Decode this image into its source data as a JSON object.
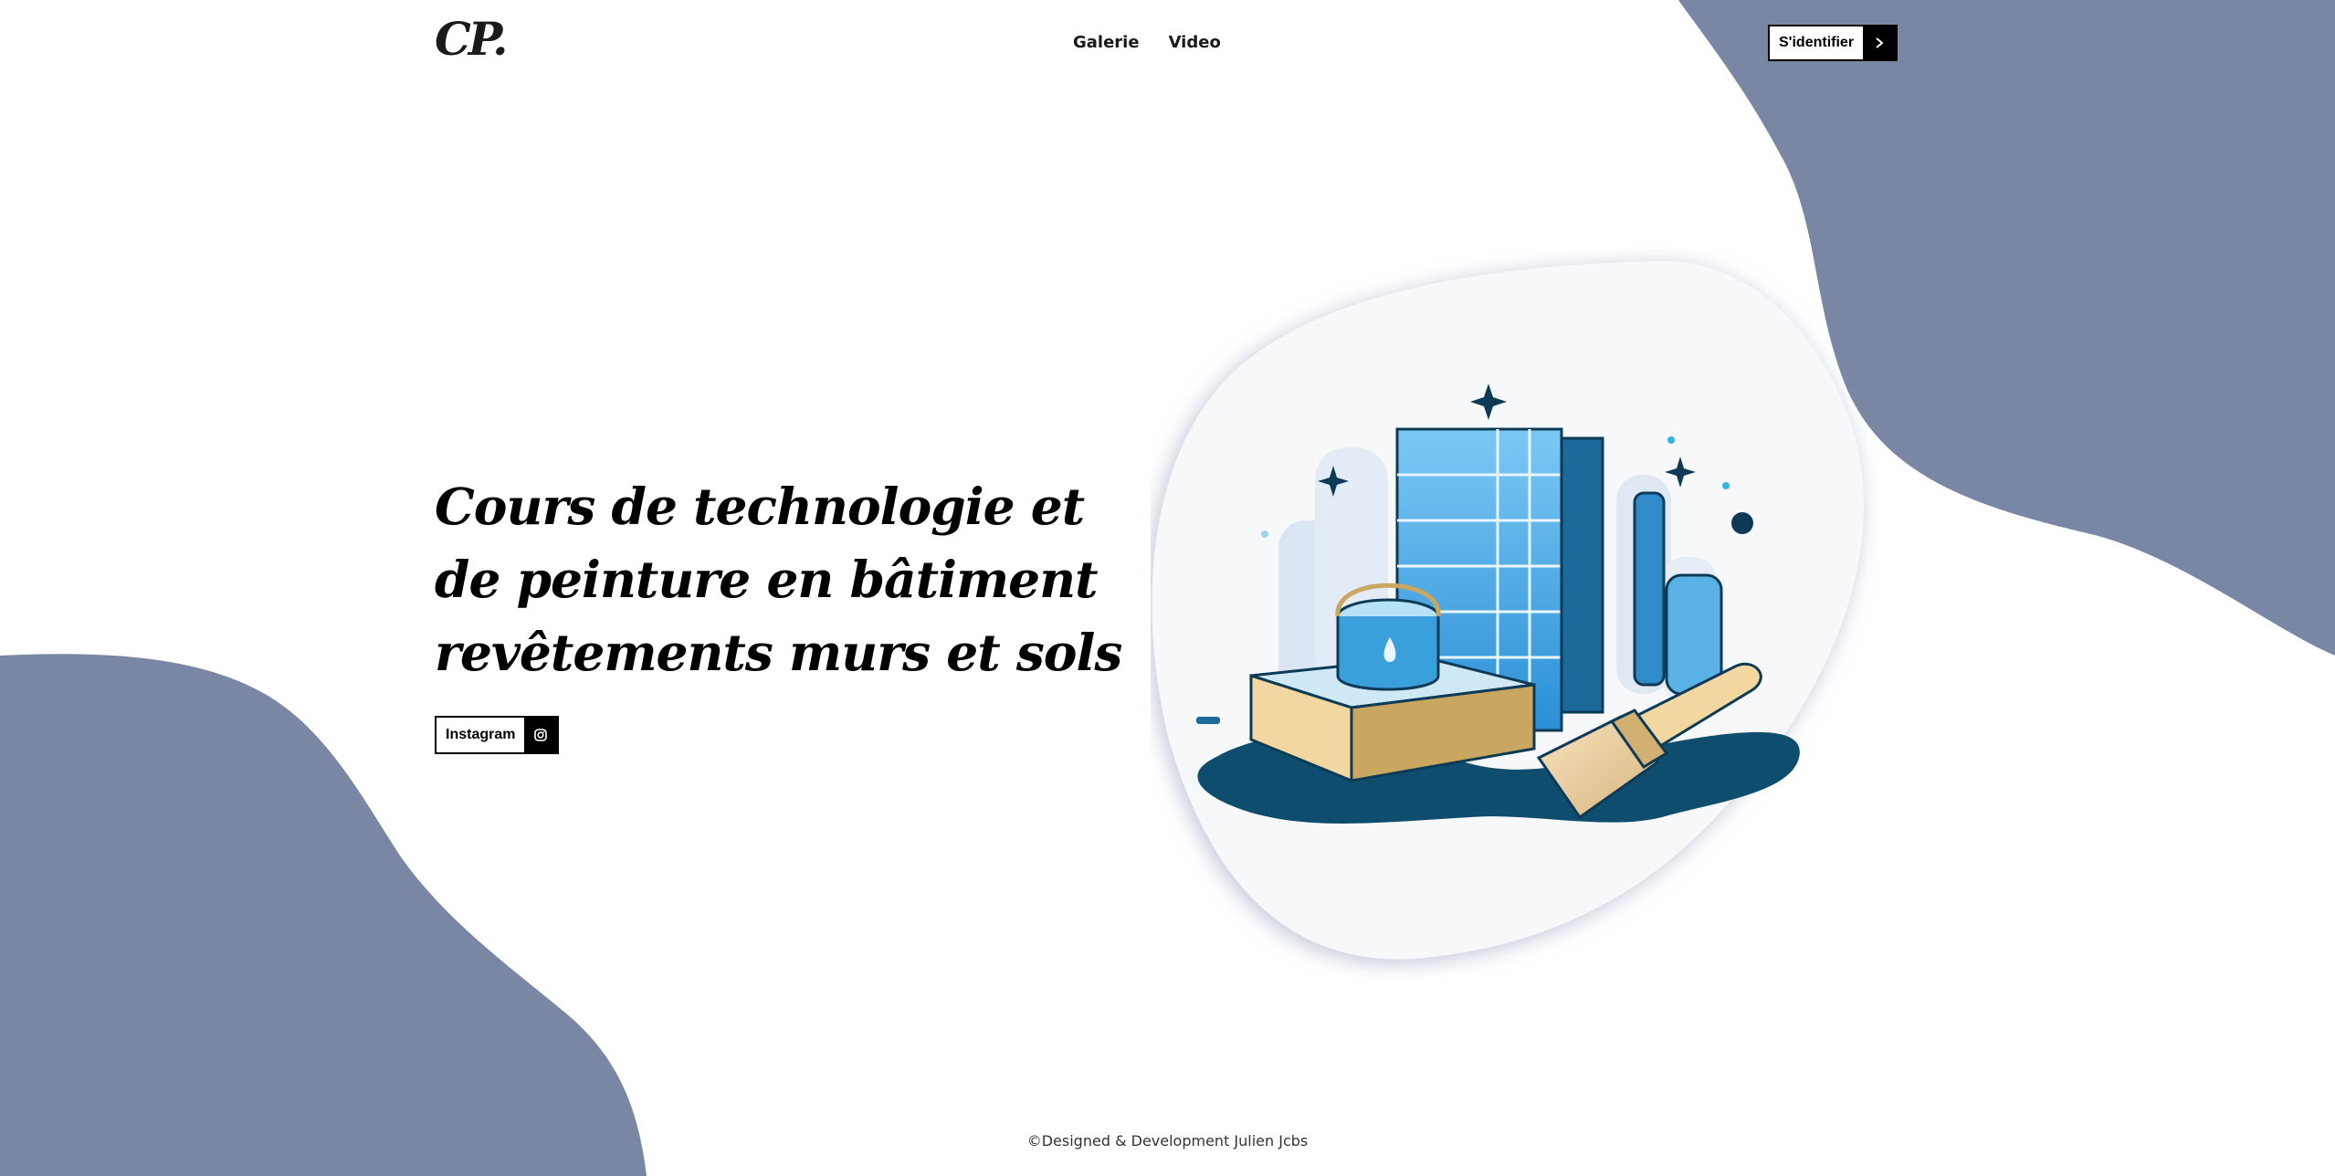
{
  "brand": {
    "logo": "CP.",
    "accent_color": "#7a87a4"
  },
  "nav": {
    "items": [
      {
        "label": "Galerie"
      },
      {
        "label": "Video"
      }
    ]
  },
  "header": {
    "login_label": "S'identifier",
    "login_icon": "chevron-right-icon"
  },
  "hero": {
    "title_lines": [
      "Cours de technologie et",
      "de peinture en bâtiment",
      "revêtements murs et sols"
    ],
    "instagram_label": "Instagram",
    "instagram_icon": "instagram-icon"
  },
  "illustration": {
    "subject": "building-and-paint-illustration"
  },
  "footer": {
    "text": "©Designed & Development Julien Jcbs"
  }
}
